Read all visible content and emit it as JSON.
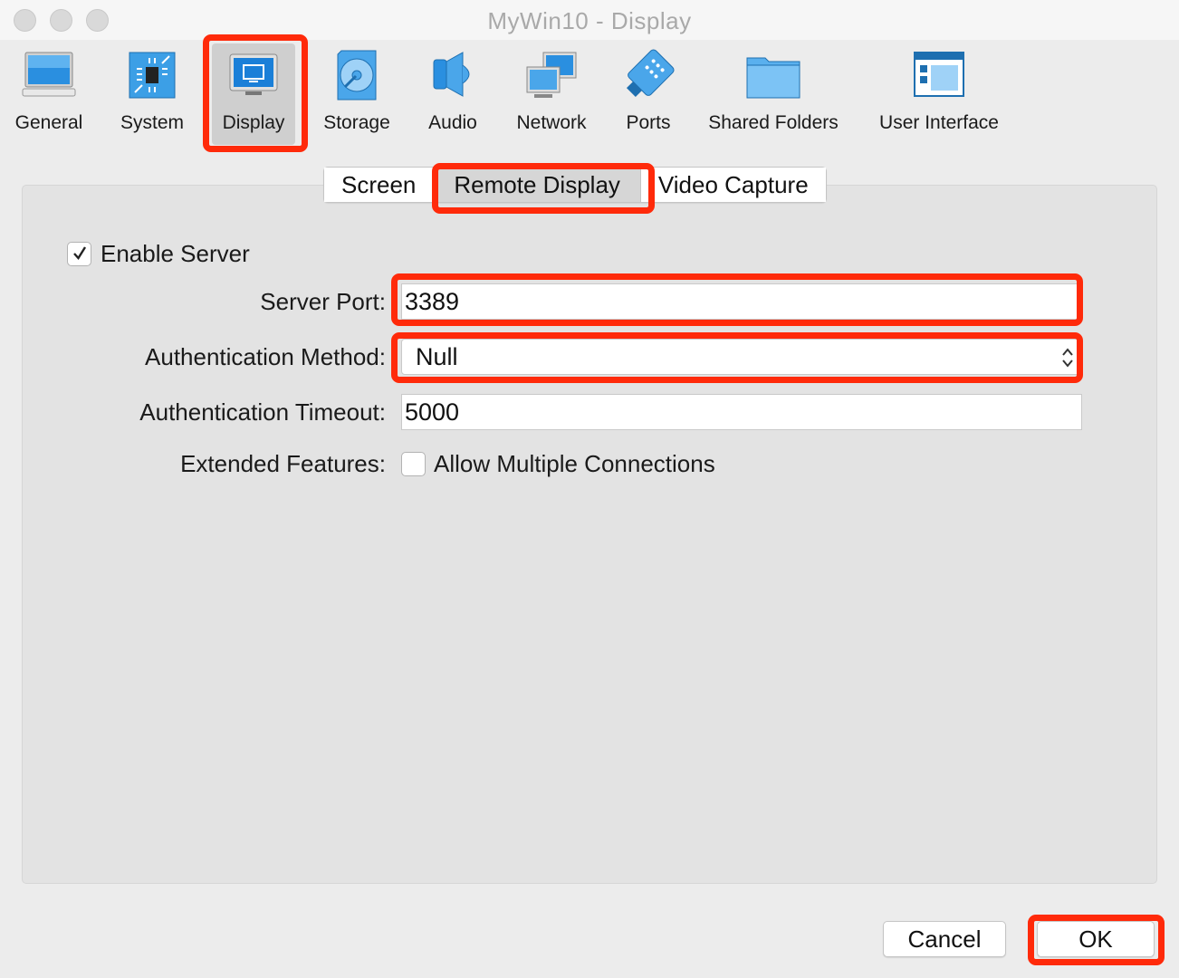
{
  "window": {
    "title": "MyWin10 - Display"
  },
  "toolbar": {
    "items": [
      {
        "label": "General",
        "icon": "general-icon"
      },
      {
        "label": "System",
        "icon": "system-icon"
      },
      {
        "label": "Display",
        "icon": "display-icon",
        "selected": true
      },
      {
        "label": "Storage",
        "icon": "storage-icon"
      },
      {
        "label": "Audio",
        "icon": "audio-icon"
      },
      {
        "label": "Network",
        "icon": "network-icon"
      },
      {
        "label": "Ports",
        "icon": "ports-icon"
      },
      {
        "label": "Shared Folders",
        "icon": "shared-folders-icon"
      },
      {
        "label": "User Interface",
        "icon": "user-interface-icon"
      }
    ]
  },
  "tabs": [
    {
      "label": "Screen",
      "active": false
    },
    {
      "label": "Remote Display",
      "active": true
    },
    {
      "label": "Video Capture",
      "active": false
    }
  ],
  "form": {
    "enable_server": {
      "label": "Enable Server",
      "checked": true
    },
    "server_port": {
      "label": "Server Port:",
      "value": "3389"
    },
    "auth_method": {
      "label": "Authentication Method:",
      "value": "Null"
    },
    "auth_timeout": {
      "label": "Authentication Timeout:",
      "value": "5000"
    },
    "extended": {
      "label": "Extended Features:",
      "option_label": "Allow Multiple Connections",
      "checked": false
    }
  },
  "buttons": {
    "cancel": "Cancel",
    "ok": "OK"
  },
  "colors": {
    "highlight_box": "#ff2a0a",
    "icon_blue": "#1e88e5",
    "panel": "#e3e3e3"
  }
}
